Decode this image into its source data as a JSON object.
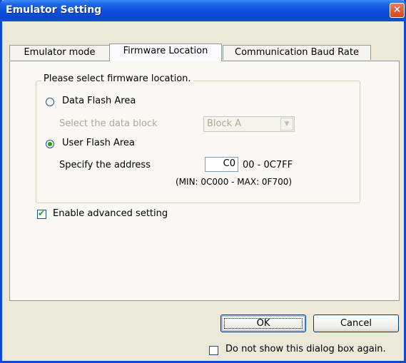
{
  "window": {
    "title": "Emulator Setting",
    "close_glyph": "✕"
  },
  "tabs": [
    {
      "label": "Emulator mode",
      "active": false
    },
    {
      "label": "Firmware Location",
      "active": true
    },
    {
      "label": "Communication Baud Rate",
      "active": false
    }
  ],
  "group": {
    "legend": "Please select firmware location.",
    "data_flash": {
      "label": "Data Flash Area",
      "selected": false,
      "block_label": "Select the data block",
      "block_value": "Block A"
    },
    "user_flash": {
      "label": "User Flash Area",
      "selected": true,
      "address_label": "Specify the address",
      "address_value": "C0",
      "address_suffix": "00 - 0C7FF",
      "range_hint": "(MIN: 0C000 - MAX: 0F700)"
    }
  },
  "advanced": {
    "label": "Enable advanced setting",
    "checked": true
  },
  "buttons": {
    "ok": "OK",
    "cancel": "Cancel"
  },
  "dont_show": {
    "label": "Do not show this dialog box again.",
    "checked": false
  },
  "colors": {
    "titlebar": "#0b49cf",
    "close_button": "#d6451e",
    "radio_dot": "#21a121",
    "check_mark": "#21a121"
  },
  "icons": {
    "close": "close-icon",
    "dropdown": "chevron-down-icon",
    "check": "checkmark-icon"
  }
}
